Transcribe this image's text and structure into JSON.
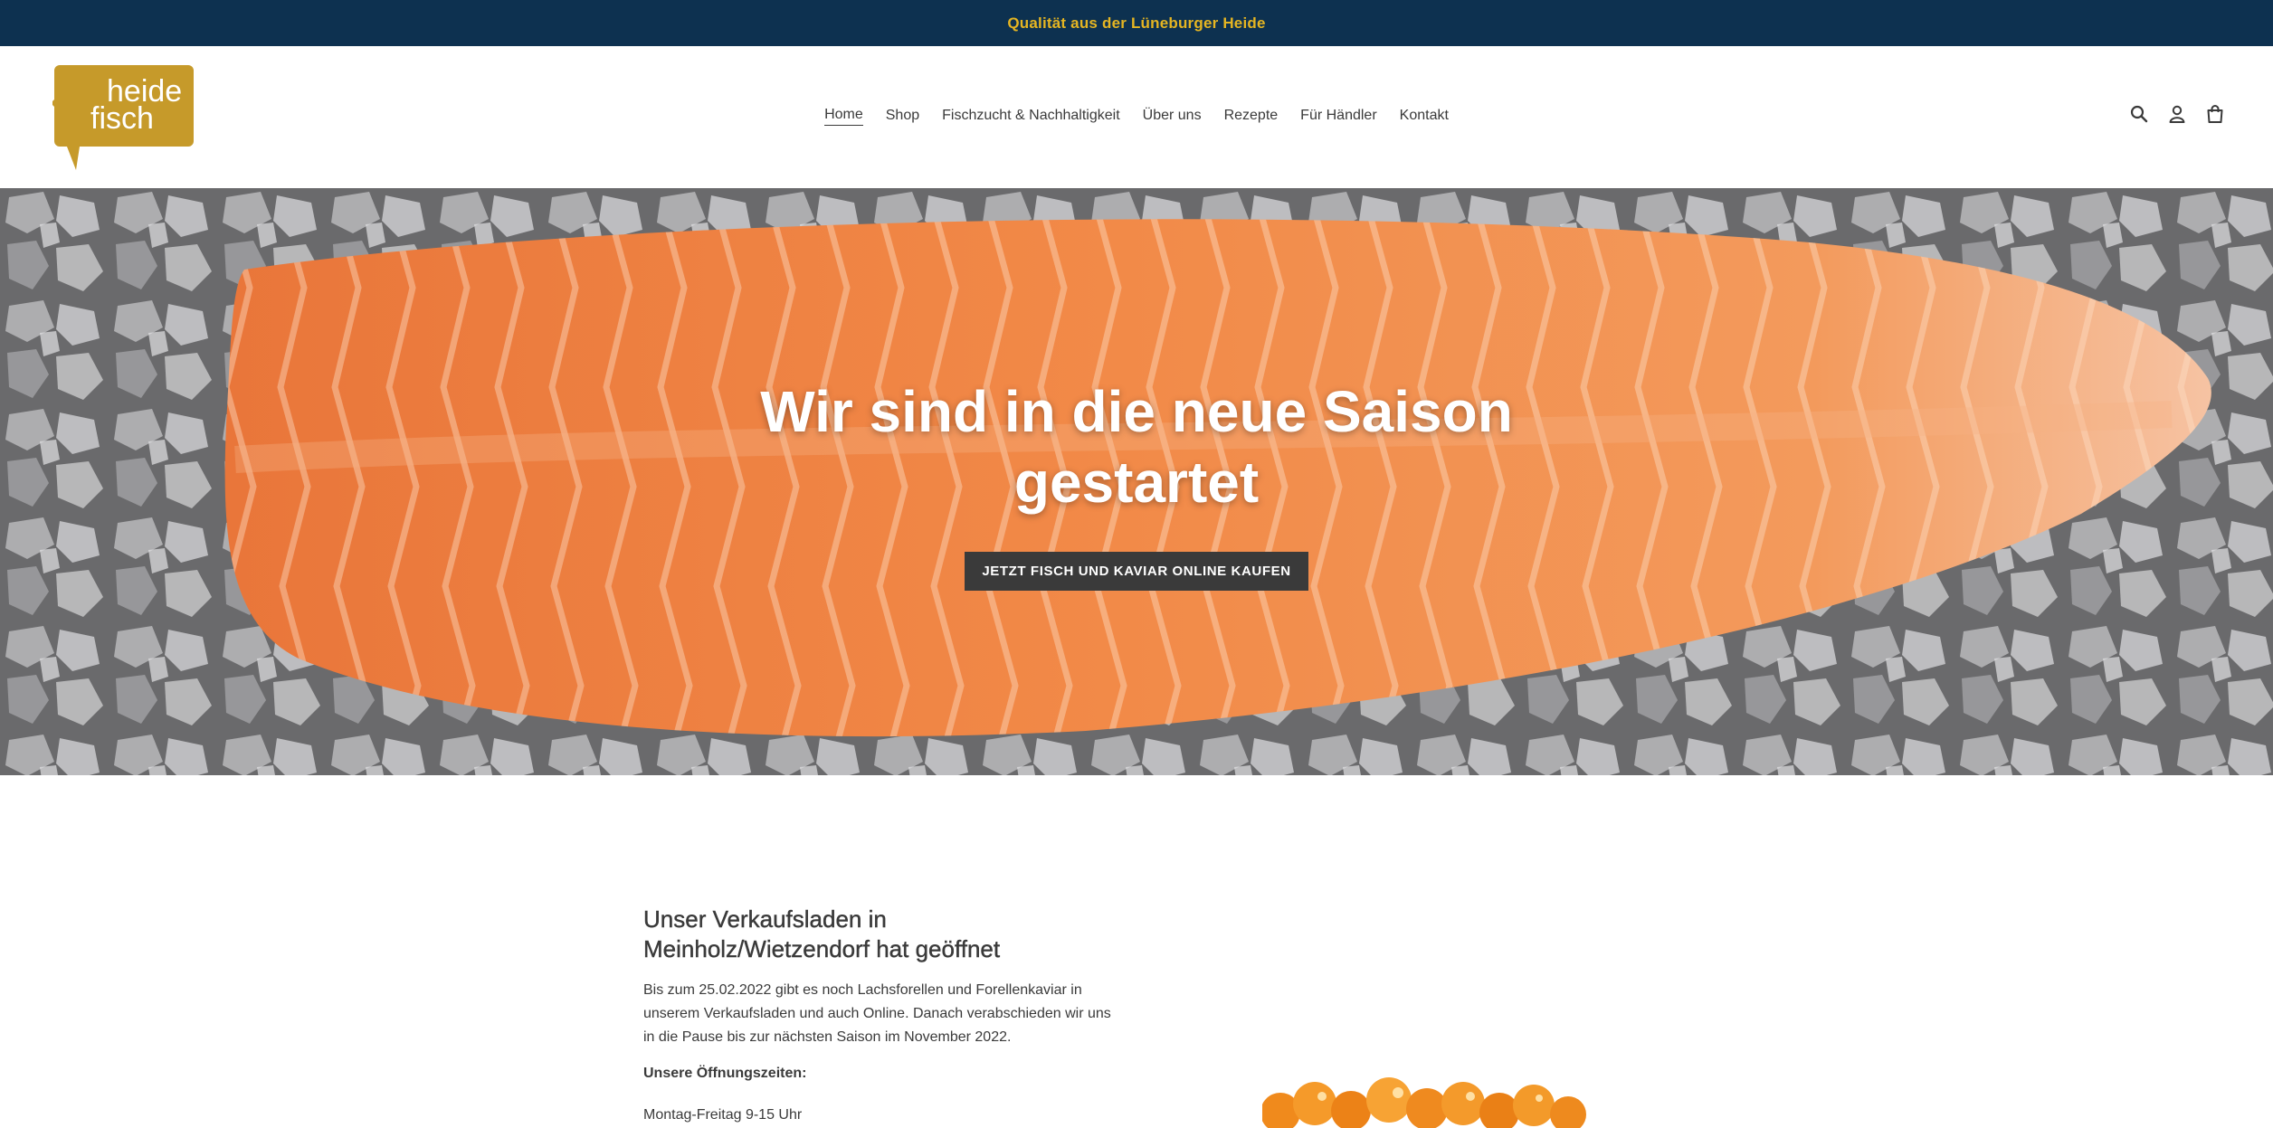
{
  "announcement": {
    "text": "Qualität aus der Lüneburger Heide",
    "bg_color": "#0d3150",
    "text_color": "#e5b522"
  },
  "header": {
    "logo": {
      "line1": "heide",
      "line2": "fisch",
      "color": "#c69a2a"
    },
    "nav": [
      {
        "label": "Home",
        "active": true
      },
      {
        "label": "Shop"
      },
      {
        "label": "Fischzucht & Nachhaltigkeit"
      },
      {
        "label": "Über uns"
      },
      {
        "label": "Rezepte"
      },
      {
        "label": "Für Händler"
      },
      {
        "label": "Kontakt"
      }
    ],
    "icons": [
      "search-icon",
      "account-icon",
      "cart-icon"
    ]
  },
  "hero": {
    "title": "Wir sind in die neue Saison gestartet",
    "cta_label": "JETZT FISCH UND KAVIAR ONLINE KAUFEN"
  },
  "content": {
    "heading": "Unser Verkaufsladen in Meinholz/Wietzendorf hat geöffnet",
    "body": "Bis zum 25.02.2022 gibt es noch Lachsforellen und Forellenkaviar in unserem Verkaufsladen und auch Online. Danach verabschieden wir uns in die Pause bis zur nächsten Saison im November 2022.",
    "hours_title": "Unsere Öffnungszeiten:",
    "hours": "Montag-Freitag 9-15 Uhr"
  }
}
